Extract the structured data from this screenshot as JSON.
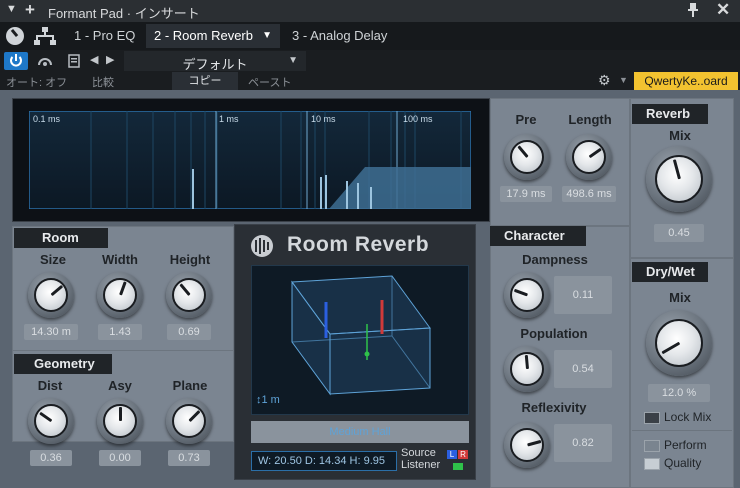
{
  "titlebar": {
    "title": "Formant Pad · インサート"
  },
  "tabs": [
    {
      "label": "1 - Pro EQ"
    },
    {
      "label": "2 - Room Reverb"
    },
    {
      "label": "3 - Analog Delay"
    }
  ],
  "preset": {
    "name": "デフォルト"
  },
  "commands": {
    "auto": "オート: オフ",
    "compare": "比較",
    "copy": "コピー",
    "paste": "ペースト"
  },
  "keyboard": {
    "label": "QwertyKe..oard"
  },
  "display": {
    "markers": [
      "0.1 ms",
      "1 ms",
      "10 ms",
      "100 ms"
    ]
  },
  "room": {
    "title": "Room",
    "size_label": "Size",
    "size_value": "14.30 m",
    "width_label": "Width",
    "width_value": "1.43",
    "height_label": "Height",
    "height_value": "0.69"
  },
  "geometry": {
    "title": "Geometry",
    "dist_label": "Dist",
    "dist_value": "0.36",
    "asy_label": "Asy",
    "asy_value": "0.00",
    "plane_label": "Plane",
    "plane_value": "0.73"
  },
  "center": {
    "brand": "Room Reverb",
    "scale": "↕1 m",
    "preset": "Medium Hall",
    "dims": "W: 20.50  D: 14.34  H: 9.95",
    "source_label": "Source",
    "listener_label": "Listener",
    "l": "L",
    "r": "R"
  },
  "timing": {
    "pre_label": "Pre",
    "pre_value": "17.9 ms",
    "length_label": "Length",
    "length_value": "498.6 ms"
  },
  "character": {
    "title": "Character",
    "dampness_label": "Dampness",
    "dampness_value": "0.11",
    "population_label": "Population",
    "population_value": "0.54",
    "reflexivity_label": "Reflexivity",
    "reflexivity_value": "0.82"
  },
  "reverb": {
    "title": "Reverb",
    "mix_label": "Mix",
    "mix_value": "0.45"
  },
  "drywet": {
    "title": "Dry/Wet",
    "mix_label": "Mix",
    "mix_value": "12.0 %",
    "lock_label": "Lock Mix",
    "perform_label": "Perform",
    "quality_label": "Quality"
  },
  "colors": {
    "accent": "#1e78c8",
    "keyboard_bg": "#f2c230",
    "display_bg": "#14293a",
    "panel": "#7b8591",
    "header": "#202428"
  },
  "icons": [
    "menu-chevron-icon",
    "add-icon",
    "pin-icon",
    "close-icon",
    "power-icon",
    "routing-icon",
    "preset-menu-icon",
    "prev-icon",
    "next-icon",
    "gear-icon",
    "presonus-logo-icon"
  ]
}
